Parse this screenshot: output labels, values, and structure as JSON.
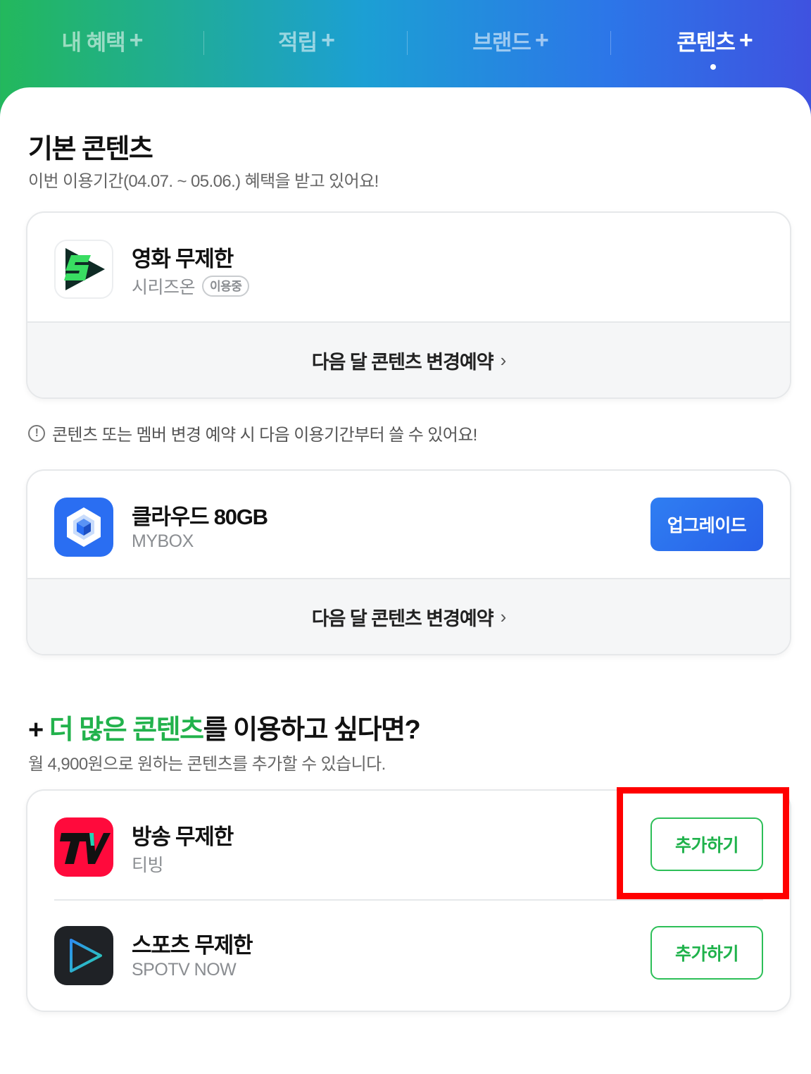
{
  "tabs": [
    {
      "label": "내 혜택",
      "plus": "+"
    },
    {
      "label": "적립",
      "plus": "+"
    },
    {
      "label": "브랜드",
      "plus": "+"
    },
    {
      "label": "콘텐츠",
      "plus": "+"
    }
  ],
  "active_tab": "콘텐츠",
  "basic": {
    "title": "기본 콘텐츠",
    "subtitle": "이번 이용기간(04.07. ~ 05.06.) 혜택을 받고 있어요!",
    "movie": {
      "name": "영화 무제한",
      "provider": "시리즈온",
      "badge": "이용중",
      "footer": "다음 달 콘텐츠 변경예약",
      "icon": "serieson-logo"
    },
    "notice": "콘텐츠 또는 멤버 변경 예약 시 다음 이용기간부터 쓸 수 있어요!",
    "cloud": {
      "name": "클라우드 80GB",
      "provider": "MYBOX",
      "button": "업그레이드",
      "footer": "다음 달 콘텐츠 변경예약",
      "icon": "mybox-cube-icon"
    }
  },
  "more": {
    "title_prefix": "+",
    "title_highlight": "더 많은 콘텐츠",
    "title_rest": "를 이용하고 싶다면?",
    "subtitle": "월 4,900원으로 원하는 콘텐츠를 추가할 수 있습니다.",
    "items": [
      {
        "name": "방송 무제한",
        "provider": "티빙",
        "button": "추가하기",
        "icon": "tving-logo"
      },
      {
        "name": "스포츠 무제한",
        "provider": "SPOTV NOW",
        "button": "추가하기",
        "icon": "spotv-play-icon"
      }
    ]
  },
  "colors": {
    "accent_green": "#22b24c",
    "upgrade_blue": "#2f7ef2",
    "highlight_red": "#ff0000"
  },
  "chevron": "›"
}
